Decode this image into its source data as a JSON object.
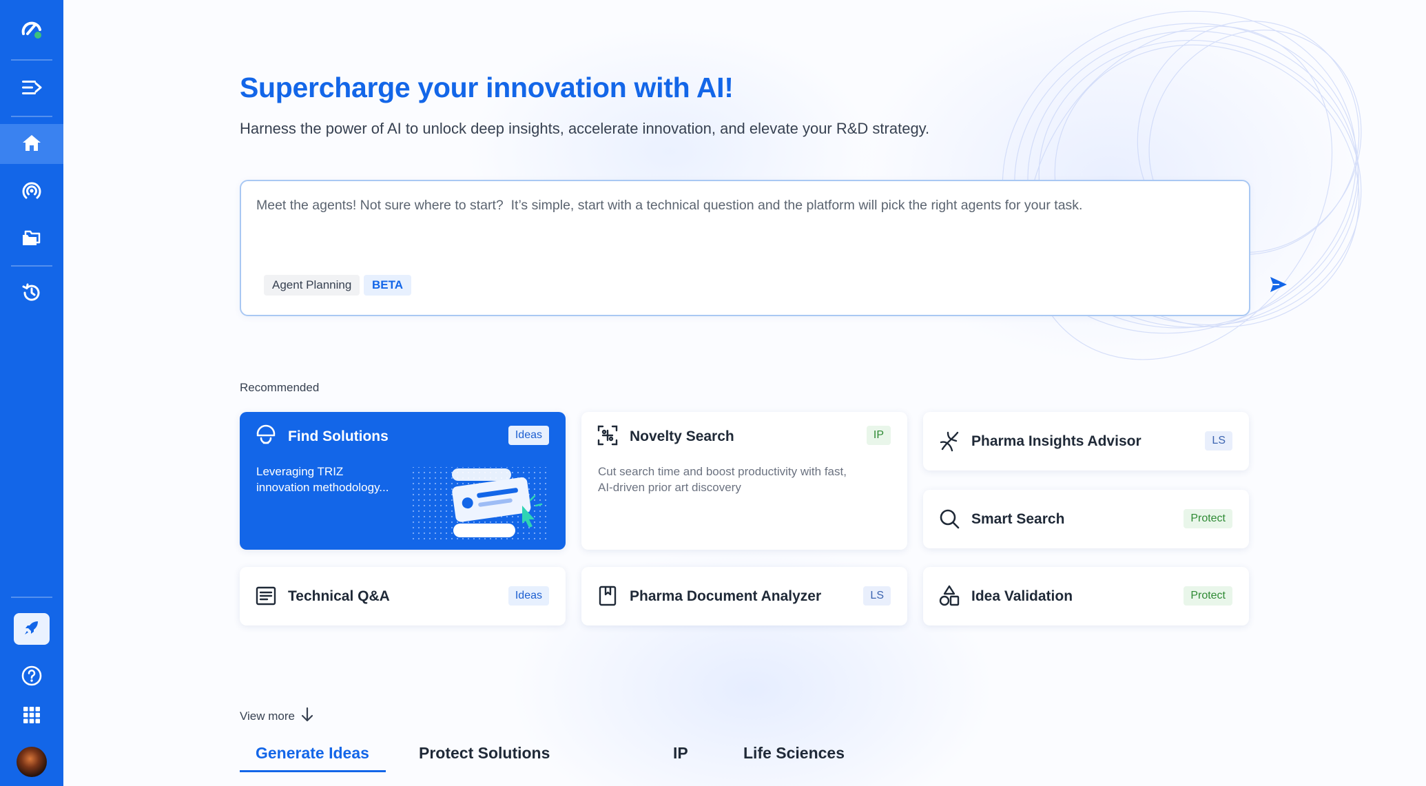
{
  "colors": {
    "brand": "#1366e8",
    "ideas_tag": "#1d5fd0",
    "protect_tag": "#2e8a34",
    "ip_tag": "#2e8a34",
    "ls_tag": "#3c64b0"
  },
  "sidebar": {
    "logo_icon": "app-logo-icon",
    "items": [
      {
        "name": "expand-menu",
        "icon": "menu-arrow-icon"
      },
      {
        "name": "home",
        "icon": "home-icon",
        "active": true
      },
      {
        "name": "radar",
        "icon": "radar-icon"
      },
      {
        "name": "folders",
        "icon": "folder-icon"
      },
      {
        "name": "history",
        "icon": "history-icon"
      }
    ],
    "bottom": [
      {
        "name": "launch",
        "icon": "rocket-icon"
      },
      {
        "name": "help",
        "icon": "help-icon"
      },
      {
        "name": "apps",
        "icon": "grid-icon"
      },
      {
        "name": "profile",
        "icon": "avatar"
      }
    ]
  },
  "hero": {
    "title": "Supercharge your innovation with AI!",
    "subtitle": "Harness the power of AI to unlock deep insights, accelerate innovation, and elevate your R&D strategy."
  },
  "prompt": {
    "placeholder": "Meet the agents! Not sure where to start?  It’s simple, start with a technical question and the platform will pick the right agents for your task.",
    "value": "",
    "agent_chip": "Agent Planning",
    "beta_chip": "BETA",
    "send_icon": "send-icon"
  },
  "recommended": {
    "label": "Recommended",
    "cards": {
      "find_solutions": {
        "title": "Find Solutions",
        "tag": "Ideas",
        "desc_line1": "Leveraging TRIZ",
        "desc_line2": "innovation methodology...",
        "icon": "lightbulb-icon"
      },
      "novelty_search": {
        "title": "Novelty Search",
        "tag": "IP",
        "desc_line1": "Cut search time and boost productivity with fast,",
        "desc_line2": "AI-driven prior art discovery",
        "icon": "scan-icon"
      },
      "pharma_insights": {
        "title": "Pharma Insights Advisor",
        "tag": "LS",
        "icon": "dna-icon"
      },
      "smart_search": {
        "title": "Smart Search",
        "tag": "Protect",
        "icon": "search-icon"
      },
      "technical_qa": {
        "title": "Technical Q&A",
        "tag": "Ideas",
        "icon": "document-lines-icon"
      },
      "pharma_doc": {
        "title": "Pharma Document Analyzer",
        "tag": "LS",
        "icon": "bookmark-doc-icon"
      },
      "idea_validation": {
        "title": "Idea Validation",
        "tag": "Protect",
        "icon": "shapes-icon"
      }
    }
  },
  "view_more": "View more",
  "tabs": [
    {
      "label": "Generate Ideas",
      "active": true
    },
    {
      "label": "Protect Solutions"
    },
    {
      "label": "IP"
    },
    {
      "label": "Life Sciences"
    }
  ]
}
